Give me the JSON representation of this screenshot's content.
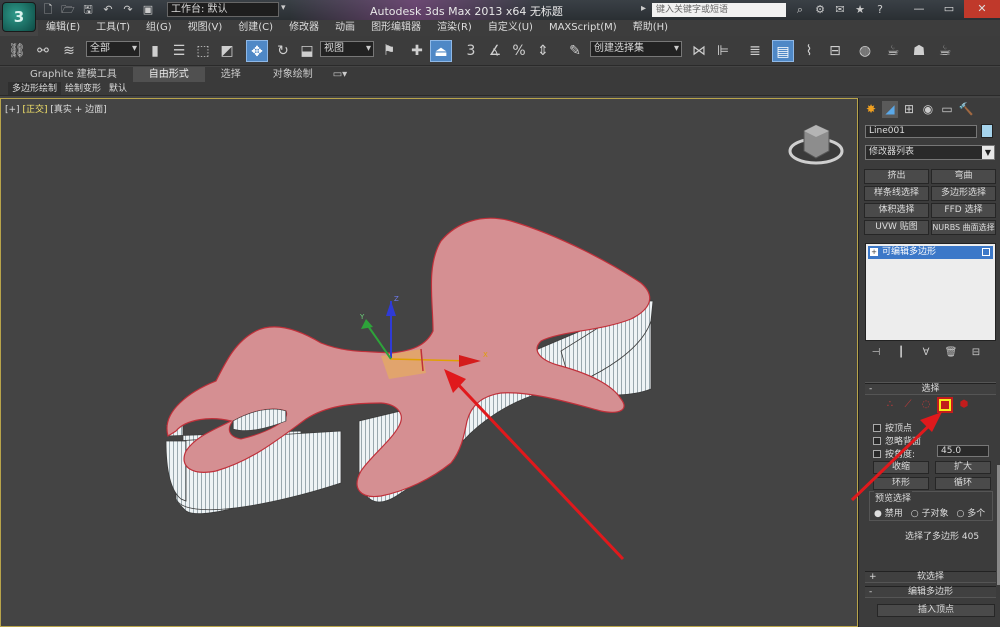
{
  "app": {
    "title": "Autodesk 3ds Max  2013 x64      无标题",
    "logo_text": "3",
    "workspace": "工作台: 默认",
    "search_placeholder": "键入关键字或短语"
  },
  "menu": [
    "编辑(E)",
    "工具(T)",
    "组(G)",
    "视图(V)",
    "创建(C)",
    "修改器",
    "动画",
    "图形编辑器",
    "渲染(R)",
    "自定义(U)",
    "MAXScript(M)",
    "帮助(H)"
  ],
  "toolbar": {
    "selection_filter": "全部",
    "ref_coord": "视图",
    "named_selection": "创建选择集",
    "snap_number": "3"
  },
  "ribbon": {
    "tabs": [
      "Graphite 建模工具",
      "自由形式",
      "选择",
      "对象绘制"
    ],
    "subtabs": [
      "多边形绘制",
      "绘制变形",
      "默认"
    ]
  },
  "viewport": {
    "label_plus": "[+]",
    "label_view": "[正交]",
    "label_shading": "[真实 + 边面]",
    "gizmo_axes": {
      "x": "X",
      "y": "Y",
      "z": "Z"
    },
    "colors": {
      "shape": "#d58f92",
      "shape_edge": "#c0303a",
      "side": "#e8eef0",
      "arrow": "#e0191c"
    }
  },
  "command_panel": {
    "object_name": "Line001",
    "object_color": "#a5d3ec",
    "modifier_list": "修改器列表",
    "modifier_buttons": [
      "挤出",
      "弯曲",
      "样条线选择",
      "多边形选择",
      "体积选择",
      "FFD 选择",
      "UVW 贴图",
      "NURBS 曲面选择"
    ],
    "stack_item": "可编辑多边形",
    "rollouts": {
      "selection": {
        "title": "选择",
        "by_vertex": "按顶点",
        "ignore_backfacing": "忽略背面",
        "by_angle": "按角度:",
        "angle_value": "45.0",
        "shrink": "收缩",
        "grow": "扩大",
        "ring": "环形",
        "loop": "循环",
        "preview_title": "预览选择",
        "preview_off": "禁用",
        "preview_sub": "子对象",
        "preview_multi": "多个",
        "status": "选择了多边形 405"
      },
      "soft_selection": {
        "title": "软选择"
      },
      "edit_polygons": {
        "title": "编辑多边形",
        "insert_vertex": "插入顶点"
      }
    }
  }
}
